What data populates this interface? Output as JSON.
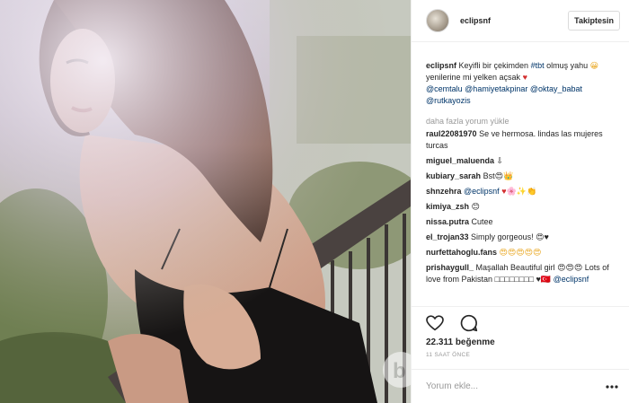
{
  "post": {
    "username": "eclipsnf",
    "follow_label": "Takiptesin",
    "caption": {
      "user": "eclipsnf",
      "text1": "Keyifli bir çekimden ",
      "hashtag": "#tbt",
      "text2": " olmuş yahu ",
      "emoji1": "😀",
      "text3": "yenilerine mi yelken açsak ",
      "heart": "♥",
      "mentions": [
        "@cemtalu",
        "@hamiyetakpinar",
        "@oktay_babat",
        "@rutkayozis"
      ]
    },
    "more_comments": "daha fazla yorum yükle",
    "comments": [
      {
        "user": "raul22081970",
        "text": "Se ve hermosa. lindas las mujeres turcas"
      },
      {
        "user": "miguel_maluenda",
        "text": "⇩"
      },
      {
        "user": "kubiary_sarah",
        "text": "Bst😍👑"
      },
      {
        "user": "shnzehra",
        "mention": "@eclipsnf",
        "text": "♥🌸✨👏"
      },
      {
        "user": "kimiya_zsh",
        "text": "😊"
      },
      {
        "user": "nissa.putra",
        "text": "Cutee"
      },
      {
        "user": "el_trojan33",
        "text": "Simply gorgeous! 😍♥"
      },
      {
        "user": "nurfettahoglu.fans",
        "text": "😍😍😍😍😍"
      },
      {
        "user": "prishaygull_",
        "text": "Maşallah Beautiful girl 😍😍😍 Lots of love from Pakistan □□□□□□□□ ♥🇹🇷",
        "mention": "@eclipsnf"
      }
    ],
    "likes": "22.311 beğenme",
    "time": "11 SAAT ÖNCE",
    "comment_placeholder": "Yorum ekle..."
  },
  "icons": {
    "like": "heart-outline-icon",
    "comment": "speech-bubble-icon",
    "more": "more-dots-icon"
  }
}
